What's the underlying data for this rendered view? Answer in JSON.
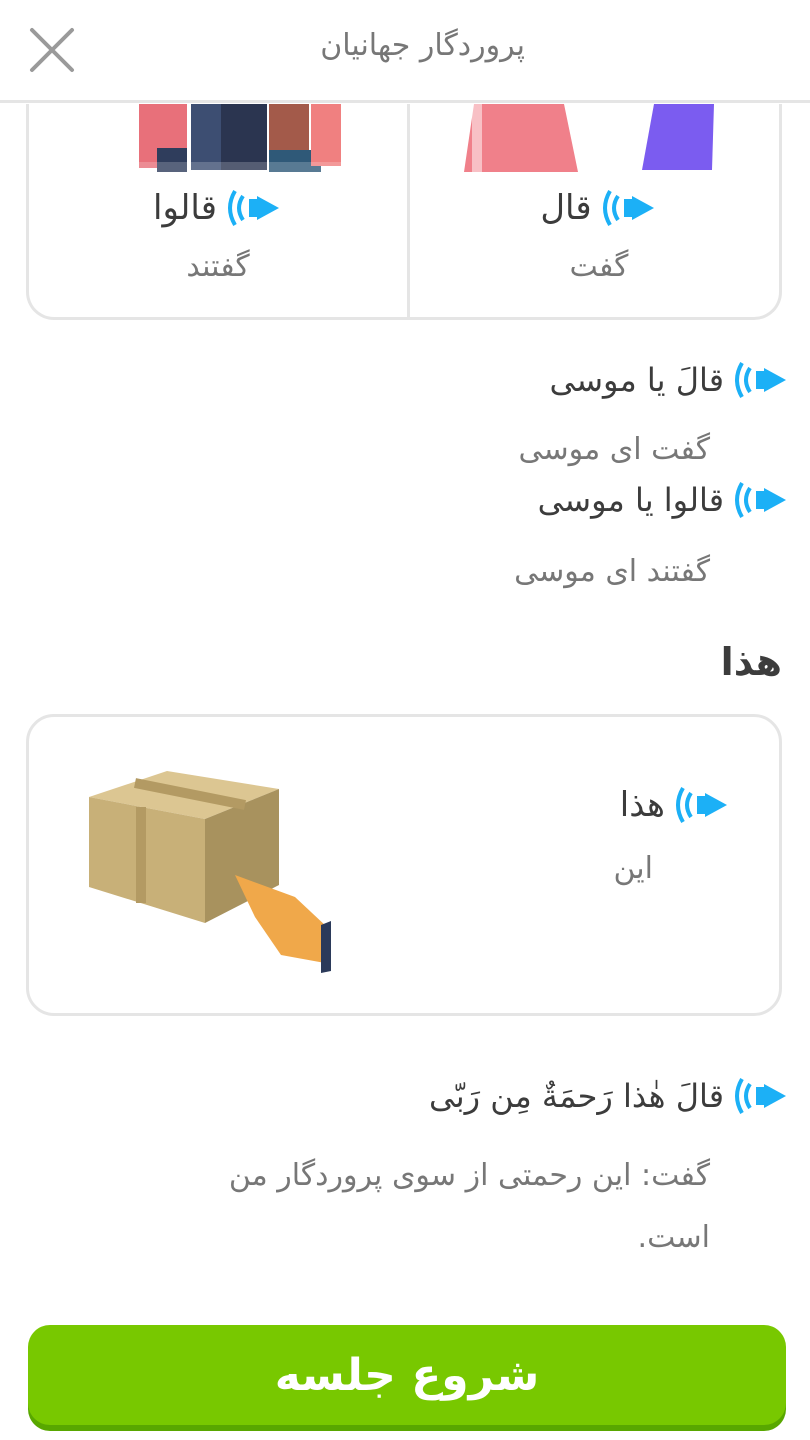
{
  "header": {
    "title": "پروردگار جهانیان"
  },
  "vocab_cards": [
    {
      "arabic": "قال",
      "persian": "گفت"
    },
    {
      "arabic": "قالوا",
      "persian": "گفتند"
    }
  ],
  "phrases": [
    {
      "arabic": "قالَ یا موسی",
      "persian": "گفت ای موسی"
    },
    {
      "arabic": "قالوا یا موسی",
      "persian": "گفتند ای موسی"
    }
  ],
  "section": {
    "title": "هذا"
  },
  "word_card": {
    "arabic": "هذا",
    "persian": "این"
  },
  "sentence": {
    "arabic": "قالَ هٰذا رَحمَةٌ مِن رَبّی",
    "persian": "گفت: این رحمتی از سوی پروردگار من است."
  },
  "start_button": {
    "label": "شروع جلسه"
  },
  "colors": {
    "accent_green": "#78c800",
    "speaker_blue": "#1cb0f6",
    "border": "#e5e5e5"
  }
}
